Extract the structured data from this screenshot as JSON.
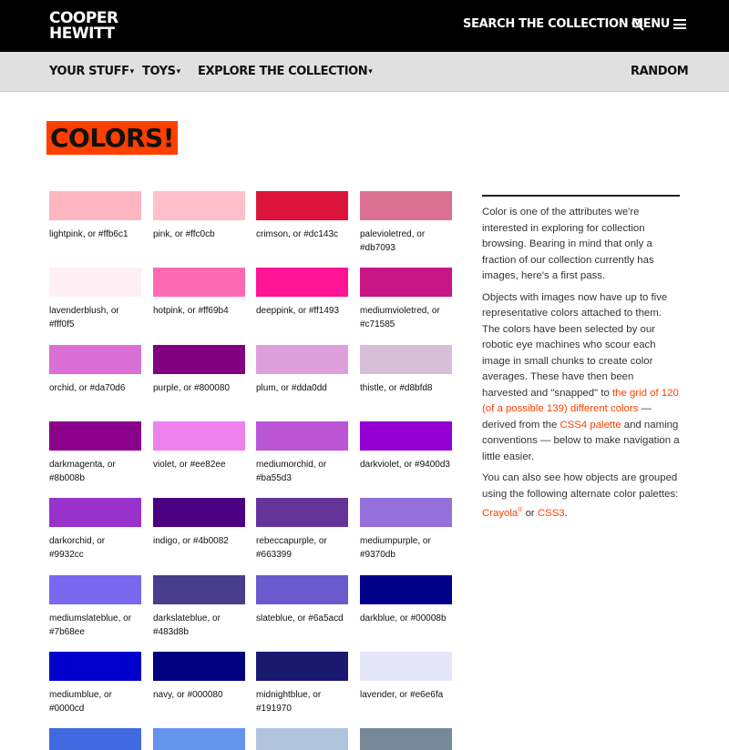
{
  "header": {
    "logo_line1": "COOPER",
    "logo_line2": "HEWITT",
    "search_label": "SEARCH THE COLLECTION",
    "menu_label": "MENU"
  },
  "subnav": {
    "your_stuff": "YOUR STUFF",
    "toys": "TOYS",
    "explore": "EXPLORE THE COLLECTION",
    "random": "RANDOM"
  },
  "page": {
    "title": "COLORS!"
  },
  "colors": [
    {
      "label": "lightpink, or #ffb6c1",
      "hex": "#ffb6c1"
    },
    {
      "label": "pink, or #ffc0cb",
      "hex": "#ffc0cb"
    },
    {
      "label": "crimson, or #dc143c",
      "hex": "#dc143c"
    },
    {
      "label": "palevioletred, or #db7093",
      "hex": "#db7093"
    },
    {
      "label": "lavenderblush, or #fff0f5",
      "hex": "#fff0f5"
    },
    {
      "label": "hotpink, or #ff69b4",
      "hex": "#ff69b4"
    },
    {
      "label": "deeppink, or #ff1493",
      "hex": "#ff1493"
    },
    {
      "label": "mediumvioletred, or #c71585",
      "hex": "#c71585"
    },
    {
      "label": "orchid, or #da70d6",
      "hex": "#da70d6"
    },
    {
      "label": "purple, or #800080",
      "hex": "#800080"
    },
    {
      "label": "plum, or #dda0dd",
      "hex": "#dda0dd"
    },
    {
      "label": "thistle, or #d8bfd8",
      "hex": "#d8bfd8"
    },
    {
      "label": "darkmagenta, or #8b008b",
      "hex": "#8b008b"
    },
    {
      "label": "violet, or #ee82ee",
      "hex": "#ee82ee"
    },
    {
      "label": "mediumorchid, or #ba55d3",
      "hex": "#ba55d3"
    },
    {
      "label": "darkviolet, or #9400d3",
      "hex": "#9400d3"
    },
    {
      "label": "darkorchid, or #9932cc",
      "hex": "#9932cc"
    },
    {
      "label": "indigo, or #4b0082",
      "hex": "#4b0082"
    },
    {
      "label": "rebeccapurple, or #663399",
      "hex": "#663399"
    },
    {
      "label": "mediumpurple, or #9370db",
      "hex": "#9370db"
    },
    {
      "label": "mediumslateblue, or #7b68ee",
      "hex": "#7b68ee"
    },
    {
      "label": "darkslateblue, or #483d8b",
      "hex": "#483d8b"
    },
    {
      "label": "slateblue, or #6a5acd",
      "hex": "#6a5acd"
    },
    {
      "label": "darkblue, or #00008b",
      "hex": "#00008b"
    },
    {
      "label": "mediumblue, or #0000cd",
      "hex": "#0000cd"
    },
    {
      "label": "navy, or #000080",
      "hex": "#000080"
    },
    {
      "label": "midnightblue, or #191970",
      "hex": "#191970"
    },
    {
      "label": "lavender, or #e6e6fa",
      "hex": "#e6e6fa"
    },
    {
      "label": "",
      "hex": "#4169e1"
    },
    {
      "label": "",
      "hex": "#6495ed"
    },
    {
      "label": "",
      "hex": "#b0c4de"
    },
    {
      "label": "",
      "hex": "#778899"
    }
  ],
  "sidebar": {
    "p1": "Color is one of the attributes we're interested in exploring for collection browsing. Bearing in mind that only a fraction of our collection currently has images, here's a first pass.",
    "p2_a": "Objects with images now have up to five representative colors attached to them. The colors have been selected by our robotic eye machines who scour each image in small chunks to create color averages. These have then been harvested and \"snapped\" to ",
    "p2_link1": "the grid of 120 (of a possible 139) different colors",
    "p2_b": " — derived from the ",
    "p2_link2": "CSS4 palette",
    "p2_c": " and naming conventions — below to make navigation a little easier.",
    "p3_a": "You can also see how objects are grouped using the following alternate color palettes: ",
    "p3_link1": "Crayola",
    "p3_reg": "®",
    "p3_b": " or ",
    "p3_link2": "CSS3",
    "p3_c": "."
  },
  "colors_accent": {
    "brand_orange": "#ff3f00",
    "topbar": "#000000",
    "subnav_bg": "#e0e0e0"
  }
}
